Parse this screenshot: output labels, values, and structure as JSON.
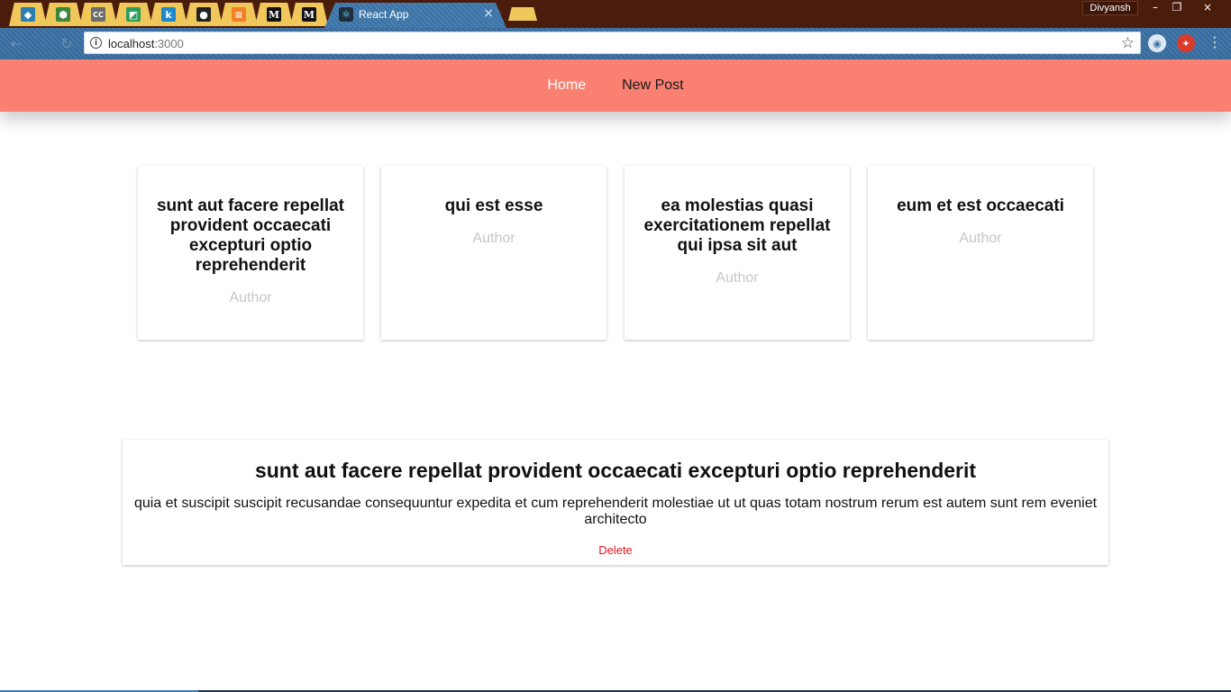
{
  "browser": {
    "pinned_tabs": [
      {
        "icon": "bird-icon",
        "glyph": "◆",
        "bg": "#2c7fb0"
      },
      {
        "icon": "node-icon",
        "glyph": "⬢",
        "bg": "#3c873a"
      },
      {
        "icon": "cc-icon",
        "glyph": "CC",
        "bg": "#6b6b6b"
      },
      {
        "icon": "chart-icon",
        "glyph": "◩",
        "bg": "#2d9c5a"
      },
      {
        "icon": "k-icon",
        "glyph": "k",
        "bg": "#1e88c8"
      },
      {
        "icon": "github-icon",
        "glyph": "●",
        "bg": "#222222"
      },
      {
        "icon": "stackoverflow-icon",
        "glyph": "≡",
        "bg": "#f48024"
      },
      {
        "icon": "medium-icon",
        "glyph": "M",
        "bg": "#111111"
      },
      {
        "icon": "medium-icon",
        "glyph": "M",
        "bg": "#111111"
      }
    ],
    "active_tab_title": "React App",
    "active_tab_close": "×",
    "profile_name": "Divyansh",
    "window_minimize": "–",
    "window_restore": "❐",
    "window_close": "×",
    "url_host": "localhost",
    "url_port": ":3000",
    "info_glyph": "i",
    "star_glyph": "☆",
    "menu_glyph": "⋮",
    "back_glyph": "←",
    "reload_glyph": "↻"
  },
  "nav": {
    "home_label": "Home",
    "new_post_label": "New Post",
    "background_color": "#fa8072"
  },
  "posts": [
    {
      "title": "sunt aut facere repellat provident occaecati excepturi optio reprehenderit",
      "author": "Author"
    },
    {
      "title": "qui est esse",
      "author": "Author"
    },
    {
      "title": "ea molestias quasi exercitationem repellat qui ipsa sit aut",
      "author": "Author"
    },
    {
      "title": "eum et est occaecati",
      "author": "Author"
    }
  ],
  "selected_post": {
    "title": "sunt aut facere repellat provident occaecati excepturi optio reprehenderit",
    "body": "quia et suscipit suscipit recusandae consequuntur expedita et cum reprehenderit molestiae ut ut quas totam nostrum rerum est autem sunt rem eveniet architecto",
    "delete_label": "Delete"
  }
}
